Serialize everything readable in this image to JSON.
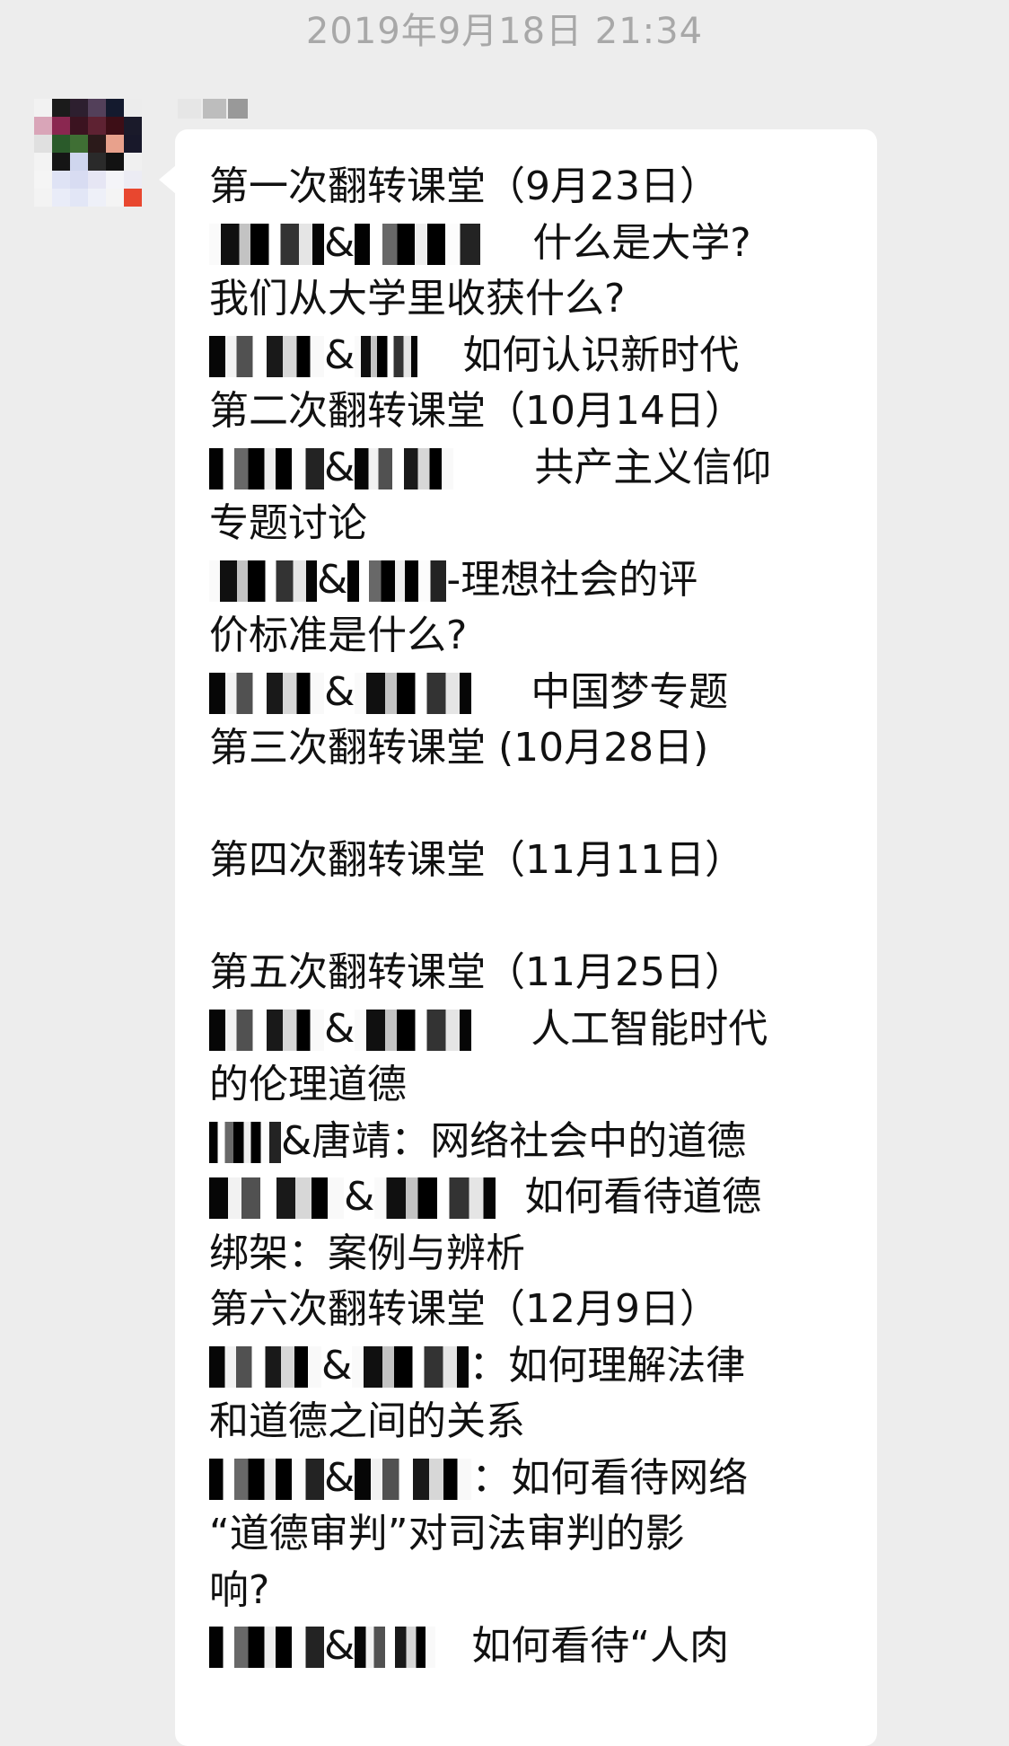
{
  "chat": {
    "timestamp": "2019年9月18日 21:34"
  },
  "message": {
    "lines": [
      {
        "prefix": "",
        "text": "第一次翻转课堂（9月23日）"
      },
      {
        "prefix": "&",
        "text": "什么是大学?"
      },
      {
        "prefix": "",
        "text": "我们从大学里收获什么?"
      },
      {
        "prefix": "&",
        "text": "如何认识新时代"
      },
      {
        "prefix": "",
        "text": "第二次翻转课堂（10月14日）"
      },
      {
        "prefix": "&",
        "text": "共产主义信仰"
      },
      {
        "prefix": "",
        "text": "专题讨论"
      },
      {
        "prefix": "&",
        "text": "-理想社会的评"
      },
      {
        "prefix": "",
        "text": "价标准是什么?"
      },
      {
        "prefix": "&",
        "text": "中国梦专题"
      },
      {
        "prefix": "",
        "text": "第三次翻转课堂 (10月28日)"
      },
      {
        "prefix": "",
        "text": ""
      },
      {
        "prefix": "",
        "text": "第四次翻转课堂（11月11日）"
      },
      {
        "prefix": "",
        "text": ""
      },
      {
        "prefix": "",
        "text": "第五次翻转课堂（11月25日）"
      },
      {
        "prefix": "&",
        "text": "人工智能时代"
      },
      {
        "prefix": "",
        "text": "的伦理道德"
      },
      {
        "prefix": "&唐靖：",
        "text": "网络社会中的道德"
      },
      {
        "prefix": "&",
        "text": "如何看待道德"
      },
      {
        "prefix": "",
        "text": "绑架：案例与辨析"
      },
      {
        "prefix": "",
        "text": "第六次翻转课堂（12月9日）"
      },
      {
        "prefix": "&",
        "text": "：如何理解法律"
      },
      {
        "prefix": "",
        "text": "和道德之间的关系"
      },
      {
        "prefix": "&",
        "text": "：如何看待网络"
      },
      {
        "prefix": "",
        "text": "“道德审判”对司法审判的影"
      },
      {
        "prefix": "",
        "text": "响?"
      },
      {
        "prefix": "&",
        "text": "如何看待“人肉"
      }
    ]
  },
  "colors": {
    "background": "#ededed",
    "bubble": "#ffffff",
    "timestamp": "#a8a8a8",
    "text": "#111111"
  }
}
